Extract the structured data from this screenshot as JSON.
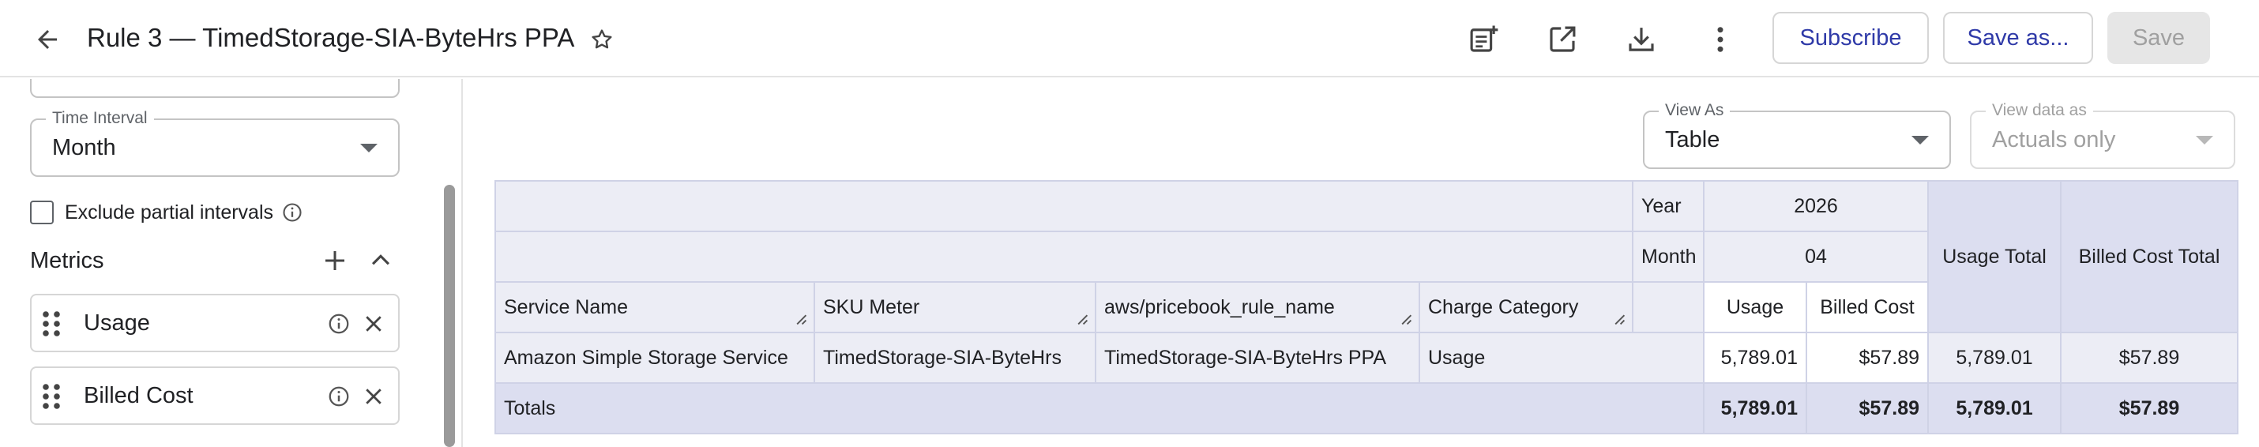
{
  "header": {
    "title": "Rule 3 — TimedStorage-SIA-ByteHrs PPA",
    "subscribe_label": "Subscribe",
    "save_as_label": "Save as...",
    "save_label": "Save"
  },
  "sidebar": {
    "time_interval": {
      "label": "Time Interval",
      "value": "Month"
    },
    "exclude_partial_label": "Exclude partial intervals",
    "metrics_title": "Metrics",
    "metrics": [
      {
        "label": "Usage"
      },
      {
        "label": "Billed Cost"
      }
    ]
  },
  "view": {
    "view_as": {
      "label": "View As",
      "value": "Table"
    },
    "view_data_as": {
      "label": "View data as",
      "value": "Actuals only"
    }
  },
  "table": {
    "year_label": "Year",
    "year_value": "2026",
    "month_label": "Month",
    "month_value": "04",
    "usage_total_header": "Usage Total",
    "billed_cost_total_header": "Billed Cost Total",
    "columns": [
      "Service Name",
      "SKU Meter",
      "aws/pricebook_rule_name",
      "Charge Category"
    ],
    "metric_headers": [
      "Usage",
      "Billed Cost"
    ],
    "row": {
      "service_name": "Amazon Simple Storage Service",
      "sku_meter": "TimedStorage-SIA-ByteHrs",
      "rule_name": "TimedStorage-SIA-ByteHrs PPA",
      "charge_category": "Usage",
      "usage": "5,789.01",
      "billed_cost": "$57.89",
      "usage_total": "5,789.01",
      "billed_cost_total": "$57.89"
    },
    "totals": {
      "label": "Totals",
      "usage": "5,789.01",
      "billed_cost": "$57.89",
      "usage_total": "5,789.01",
      "billed_cost_total": "$57.89"
    }
  },
  "colors": {
    "accent": "#2f3aa8",
    "header_cell": "#ecedf5",
    "total_cell": "#dcdef0",
    "border": "#cfd2e6"
  }
}
